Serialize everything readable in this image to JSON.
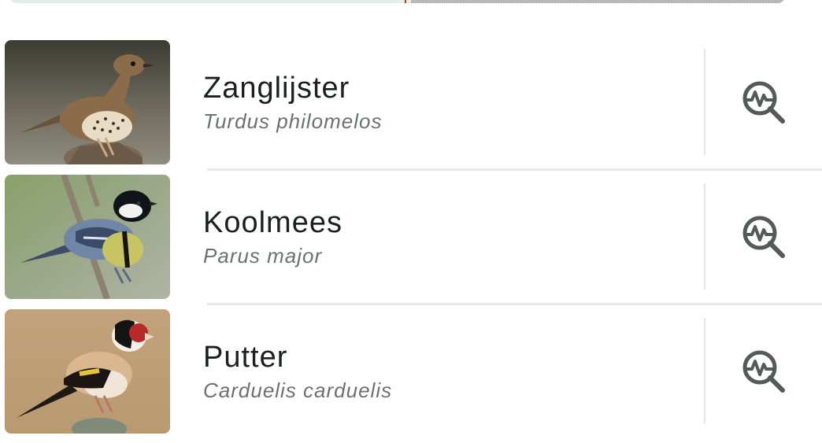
{
  "birds": [
    {
      "common_name": "Zanglijster",
      "scientific_name": "Turdus philomelos",
      "icon": "sonogram-search-icon"
    },
    {
      "common_name": "Koolmees",
      "scientific_name": "Parus major",
      "icon": "sonogram-search-icon"
    },
    {
      "common_name": "Putter",
      "scientific_name": "Carduelis carduelis",
      "icon": "sonogram-search-icon"
    }
  ],
  "colors": {
    "primary_text": "#1b1f1e",
    "secondary_text": "#6b7170",
    "icon": "#545a59",
    "divider": "#e3e6e5",
    "playhead": "#c0392b"
  }
}
